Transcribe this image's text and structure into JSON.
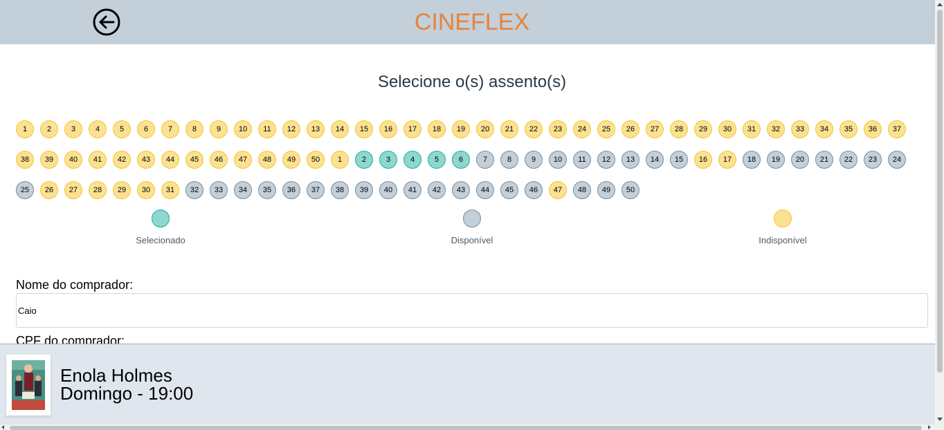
{
  "header": {
    "brand": "CINEFLEX",
    "back_icon": "arrow-left-circle-icon"
  },
  "page": {
    "title": "Selecione o(s) assento(s)"
  },
  "seats": [
    {
      "label": "1",
      "status": "unavailable"
    },
    {
      "label": "2",
      "status": "unavailable"
    },
    {
      "label": "3",
      "status": "unavailable"
    },
    {
      "label": "4",
      "status": "unavailable"
    },
    {
      "label": "5",
      "status": "unavailable"
    },
    {
      "label": "6",
      "status": "unavailable"
    },
    {
      "label": "7",
      "status": "unavailable"
    },
    {
      "label": "8",
      "status": "unavailable"
    },
    {
      "label": "9",
      "status": "unavailable"
    },
    {
      "label": "10",
      "status": "unavailable"
    },
    {
      "label": "11",
      "status": "unavailable"
    },
    {
      "label": "12",
      "status": "unavailable"
    },
    {
      "label": "13",
      "status": "unavailable"
    },
    {
      "label": "14",
      "status": "unavailable"
    },
    {
      "label": "15",
      "status": "unavailable"
    },
    {
      "label": "16",
      "status": "unavailable"
    },
    {
      "label": "17",
      "status": "unavailable"
    },
    {
      "label": "18",
      "status": "unavailable"
    },
    {
      "label": "19",
      "status": "unavailable"
    },
    {
      "label": "20",
      "status": "unavailable"
    },
    {
      "label": "21",
      "status": "unavailable"
    },
    {
      "label": "22",
      "status": "unavailable"
    },
    {
      "label": "23",
      "status": "unavailable"
    },
    {
      "label": "24",
      "status": "unavailable"
    },
    {
      "label": "25",
      "status": "unavailable"
    },
    {
      "label": "26",
      "status": "unavailable"
    },
    {
      "label": "27",
      "status": "unavailable"
    },
    {
      "label": "28",
      "status": "unavailable"
    },
    {
      "label": "29",
      "status": "unavailable"
    },
    {
      "label": "30",
      "status": "unavailable"
    },
    {
      "label": "31",
      "status": "unavailable"
    },
    {
      "label": "32",
      "status": "unavailable"
    },
    {
      "label": "33",
      "status": "unavailable"
    },
    {
      "label": "34",
      "status": "unavailable"
    },
    {
      "label": "35",
      "status": "unavailable"
    },
    {
      "label": "36",
      "status": "unavailable"
    },
    {
      "label": "37",
      "status": "unavailable"
    },
    {
      "label": "38",
      "status": "unavailable"
    },
    {
      "label": "39",
      "status": "unavailable"
    },
    {
      "label": "40",
      "status": "unavailable"
    },
    {
      "label": "41",
      "status": "unavailable"
    },
    {
      "label": "42",
      "status": "unavailable"
    },
    {
      "label": "43",
      "status": "unavailable"
    },
    {
      "label": "44",
      "status": "unavailable"
    },
    {
      "label": "45",
      "status": "unavailable"
    },
    {
      "label": "46",
      "status": "unavailable"
    },
    {
      "label": "47",
      "status": "unavailable"
    },
    {
      "label": "48",
      "status": "unavailable"
    },
    {
      "label": "49",
      "status": "unavailable"
    },
    {
      "label": "50",
      "status": "unavailable"
    },
    {
      "label": "1",
      "status": "unavailable"
    },
    {
      "label": "2",
      "status": "selected"
    },
    {
      "label": "3",
      "status": "selected"
    },
    {
      "label": "4",
      "status": "selected"
    },
    {
      "label": "5",
      "status": "selected"
    },
    {
      "label": "6",
      "status": "selected"
    },
    {
      "label": "7",
      "status": "available"
    },
    {
      "label": "8",
      "status": "available"
    },
    {
      "label": "9",
      "status": "available"
    },
    {
      "label": "10",
      "status": "available"
    },
    {
      "label": "11",
      "status": "available"
    },
    {
      "label": "12",
      "status": "available"
    },
    {
      "label": "13",
      "status": "available"
    },
    {
      "label": "14",
      "status": "available"
    },
    {
      "label": "15",
      "status": "available"
    },
    {
      "label": "16",
      "status": "unavailable"
    },
    {
      "label": "17",
      "status": "unavailable"
    },
    {
      "label": "18",
      "status": "available"
    },
    {
      "label": "19",
      "status": "available"
    },
    {
      "label": "20",
      "status": "available"
    },
    {
      "label": "21",
      "status": "available"
    },
    {
      "label": "22",
      "status": "available"
    },
    {
      "label": "23",
      "status": "available"
    },
    {
      "label": "24",
      "status": "available"
    },
    {
      "label": "25",
      "status": "available"
    },
    {
      "label": "26",
      "status": "unavailable"
    },
    {
      "label": "27",
      "status": "unavailable"
    },
    {
      "label": "28",
      "status": "unavailable"
    },
    {
      "label": "29",
      "status": "unavailable"
    },
    {
      "label": "30",
      "status": "unavailable"
    },
    {
      "label": "31",
      "status": "unavailable"
    },
    {
      "label": "32",
      "status": "available"
    },
    {
      "label": "33",
      "status": "available"
    },
    {
      "label": "34",
      "status": "available"
    },
    {
      "label": "35",
      "status": "available"
    },
    {
      "label": "36",
      "status": "available"
    },
    {
      "label": "37",
      "status": "available"
    },
    {
      "label": "38",
      "status": "available"
    },
    {
      "label": "39",
      "status": "available"
    },
    {
      "label": "40",
      "status": "available"
    },
    {
      "label": "41",
      "status": "available"
    },
    {
      "label": "42",
      "status": "available"
    },
    {
      "label": "43",
      "status": "available"
    },
    {
      "label": "44",
      "status": "available"
    },
    {
      "label": "45",
      "status": "available"
    },
    {
      "label": "46",
      "status": "available"
    },
    {
      "label": "47",
      "status": "unavailable"
    },
    {
      "label": "48",
      "status": "available"
    },
    {
      "label": "49",
      "status": "available"
    },
    {
      "label": "50",
      "status": "available"
    }
  ],
  "legend": {
    "selected": "Selecionado",
    "available": "Disponível",
    "unavailable": "Indisponível"
  },
  "colors": {
    "selected": "#8dd7cf",
    "available": "#c3cfd9",
    "unavailable": "#fbe192",
    "brand": "#e8833a"
  },
  "form": {
    "name_label": "Nome do comprador:",
    "name_value": "Caio",
    "cpf_label": "CPF do comprador:"
  },
  "footer": {
    "movie_title": "Enola Holmes",
    "session": "Domingo - 19:00"
  }
}
